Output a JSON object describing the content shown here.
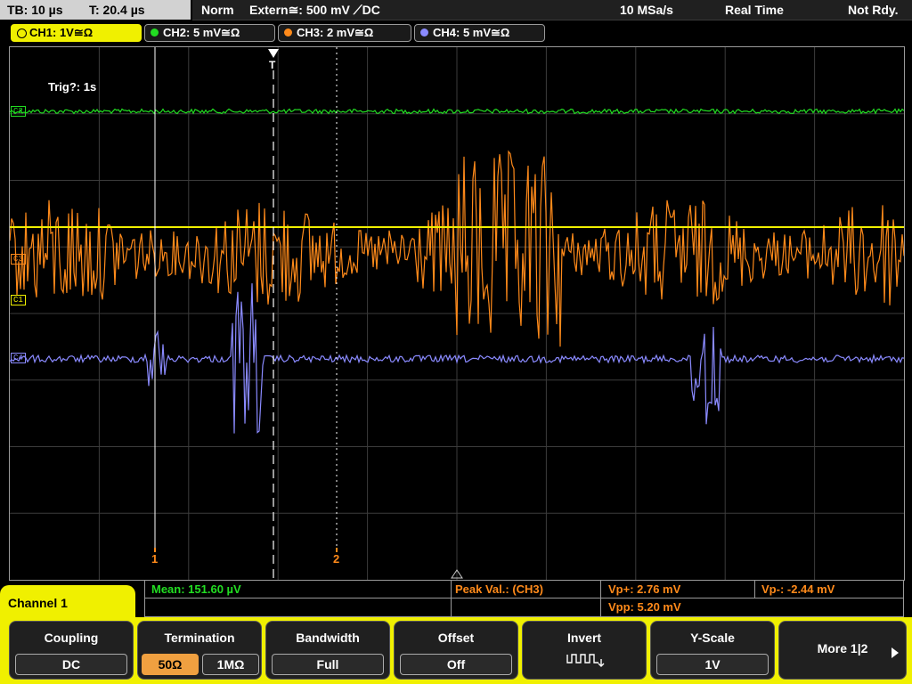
{
  "status": {
    "timebase": "TB: 10 µs",
    "time": "T: 20.4 µs",
    "mode": "Norm",
    "trigger": "Extern≅: 500 mV ⟋DC",
    "sample_rate": "10 MSa/s",
    "acq": "Real Time",
    "state": "Not Rdy."
  },
  "channels": [
    {
      "label": "CH1: 1V≅Ω",
      "color": "#f0f000"
    },
    {
      "label": "CH2: 5 mV≅Ω",
      "color": "#22dd22"
    },
    {
      "label": "CH3: 2 mV≅Ω",
      "color": "#ff8a1a"
    },
    {
      "label": "CH4: 5 mV≅Ω",
      "color": "#8a8aff"
    }
  ],
  "plot": {
    "trigger_info": "Trig?: 1s",
    "trigger_marker": "T",
    "cursor1": "1",
    "cursor2": "2",
    "markers": {
      "ch2": "C2",
      "ch3": "C3",
      "ch1": "C1",
      "ch4": "C4"
    }
  },
  "measurements": {
    "mean": "Mean: 151.60 µV",
    "peak_label": "Peak Val.: (CH3)",
    "vp_plus": "Vp+: 2.76 mV",
    "vp_minus": "Vp-: -2.44 mV",
    "vpp": "Vpp: 5.20 mV"
  },
  "panel": {
    "title": "Channel 1",
    "coupling_title": "Coupling",
    "coupling_value": "DC",
    "termination_title": "Termination",
    "term_50": "50Ω",
    "term_1m": "1MΩ",
    "bandwidth_title": "Bandwidth",
    "bandwidth_value": "Full",
    "offset_title": "Offset",
    "offset_value": "Off",
    "invert_title": "Invert",
    "yscale_title": "Y-Scale",
    "yscale_value": "1V",
    "more": "More 1|2"
  }
}
